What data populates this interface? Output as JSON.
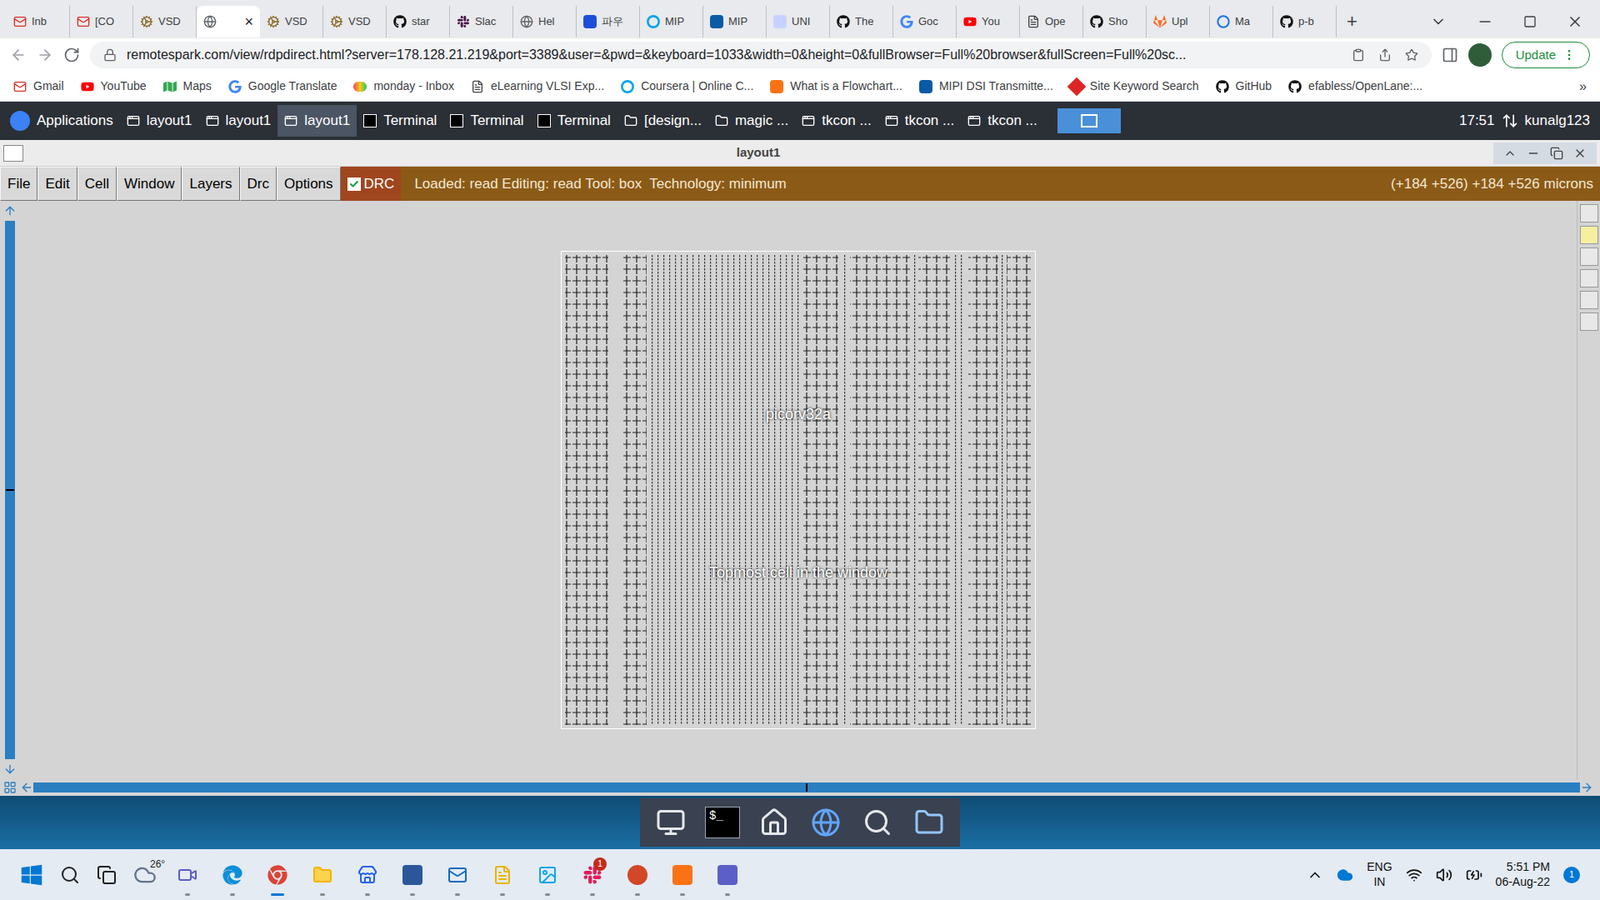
{
  "browser": {
    "tabs": [
      {
        "label": "Inb",
        "kind": "gmail",
        "selected": false
      },
      {
        "label": "[CO",
        "kind": "gmail",
        "selected": false
      },
      {
        "label": "VSD",
        "kind": "vsd",
        "selected": false
      },
      {
        "label": "",
        "kind": "globe",
        "selected": true
      },
      {
        "label": "VSD",
        "kind": "vsd",
        "selected": false
      },
      {
        "label": "VSD",
        "kind": "vsd",
        "selected": false
      },
      {
        "label": "star",
        "kind": "github",
        "selected": false
      },
      {
        "label": "Slac",
        "kind": "slack",
        "selected": false
      },
      {
        "label": "Hel",
        "kind": "globe",
        "selected": false
      },
      {
        "label": "파우",
        "kind": "naver",
        "selected": false
      },
      {
        "label": "MIP",
        "kind": "coursera",
        "selected": false
      },
      {
        "label": "MIP",
        "kind": "mipi",
        "selected": false
      },
      {
        "label": "UNI",
        "kind": "uni",
        "selected": false
      },
      {
        "label": "The",
        "kind": "github",
        "selected": false
      },
      {
        "label": "Goc",
        "kind": "google",
        "selected": false
      },
      {
        "label": "You",
        "kind": "youtube",
        "selected": false
      },
      {
        "label": "Ope",
        "kind": "doc",
        "selected": false
      },
      {
        "label": "Sho",
        "kind": "github",
        "selected": false
      },
      {
        "label": "Upl",
        "kind": "gitlab",
        "selected": false
      },
      {
        "label": "Ma",
        "kind": "badge",
        "selected": false
      },
      {
        "label": "p-b",
        "kind": "github",
        "selected": false
      }
    ],
    "close_mark": "×",
    "new_tab": "+",
    "url": "remotespark.com/view/rdpdirect.html?server=178.128.21.219&port=3389&user=&pwd=&keyboard=1033&width=0&height=0&fullBrowser=Full%20browser&fullScreen=Full%20sc...",
    "update_button": "Update",
    "bookmarks": [
      {
        "label": "Gmail",
        "kind": "gmail"
      },
      {
        "label": "YouTube",
        "kind": "youtube"
      },
      {
        "label": "Maps",
        "kind": "maps"
      },
      {
        "label": "Google Translate",
        "kind": "google"
      },
      {
        "label": "monday - Inbox",
        "kind": "monday"
      },
      {
        "label": "eLearning VLSI Exp...",
        "kind": "doc"
      },
      {
        "label": "Coursera | Online C...",
        "kind": "coursera"
      },
      {
        "label": "What is a Flowchart...",
        "kind": "flow"
      },
      {
        "label": "MIPI DSI Transmitte...",
        "kind": "mipi"
      },
      {
        "label": "Site Keyword Search",
        "kind": "keyword"
      },
      {
        "label": "GitHub",
        "kind": "github"
      },
      {
        "label": "efabless/OpenLane:...",
        "kind": "github"
      }
    ],
    "more": "»"
  },
  "desktop_panel": {
    "applications": "Applications",
    "tasks": [
      {
        "label": "layout1",
        "kind": "window",
        "selected": false
      },
      {
        "label": "layout1",
        "kind": "window",
        "selected": false
      },
      {
        "label": "layout1",
        "kind": "window",
        "selected": true
      },
      {
        "label": "Terminal",
        "kind": "terminal",
        "selected": false
      },
      {
        "label": "Terminal",
        "kind": "terminal",
        "selected": false
      },
      {
        "label": "Terminal",
        "kind": "terminal",
        "selected": false
      },
      {
        "label": "[design...",
        "kind": "folder",
        "selected": false
      },
      {
        "label": "magic ...",
        "kind": "folder",
        "selected": false
      },
      {
        "label": "tkcon ...",
        "kind": "window",
        "selected": false
      },
      {
        "label": "tkcon ...",
        "kind": "window",
        "selected": false
      },
      {
        "label": "tkcon ...",
        "kind": "window",
        "selected": false
      }
    ],
    "workspace_button": {
      "selected": true
    },
    "clock": "17:51",
    "user": "kunalg123"
  },
  "magic_window": {
    "title": "layout1",
    "menus": [
      "File",
      "Edit",
      "Cell",
      "Window",
      "Layers",
      "Drc",
      "Options"
    ],
    "drc": {
      "label": "DRC",
      "checked": true
    },
    "status": "Loaded: read Editing: read Tool: box  Technology: minimum",
    "coords": "(+184 +526) +184 +526 microns",
    "cell_name": "picorv32a",
    "cell_caption": "Topmost cell in the window",
    "toolbar_boxes": [
      {
        "selected": false
      },
      {
        "selected": true
      },
      {
        "selected": false
      },
      {
        "selected": false
      },
      {
        "selected": false
      },
      {
        "selected": false
      }
    ]
  },
  "dock": {
    "items": [
      {
        "kind": "monitor",
        "label": ""
      },
      {
        "kind": "terminal",
        "label": "$_"
      },
      {
        "kind": "home",
        "label": ""
      },
      {
        "kind": "globe",
        "label": ""
      },
      {
        "kind": "search",
        "label": ""
      },
      {
        "kind": "folder",
        "label": ""
      }
    ]
  },
  "taskbar": {
    "weather": "26°",
    "apps": [
      {
        "kind": "meet",
        "active": false,
        "badge": ""
      },
      {
        "kind": "edge",
        "active": false,
        "badge": ""
      },
      {
        "kind": "chrome",
        "active": true,
        "badge": ""
      },
      {
        "kind": "explorer",
        "active": false,
        "badge": ""
      },
      {
        "kind": "store",
        "active": false,
        "badge": ""
      },
      {
        "kind": "word",
        "active": false,
        "badge": ""
      },
      {
        "kind": "outlook",
        "active": false,
        "badge": ""
      },
      {
        "kind": "files",
        "active": false,
        "badge": ""
      },
      {
        "kind": "photos",
        "active": false,
        "badge": ""
      },
      {
        "kind": "slack",
        "active": false,
        "badge": "1"
      },
      {
        "kind": "powerpoint",
        "active": false,
        "badge": ""
      },
      {
        "kind": "gapp",
        "active": false,
        "badge": ""
      },
      {
        "kind": "teams",
        "active": false,
        "badge": ""
      }
    ],
    "language": [
      "ENG",
      "IN"
    ],
    "time": "5:51 PM",
    "date": "06-Aug-22",
    "notifications": "1"
  }
}
